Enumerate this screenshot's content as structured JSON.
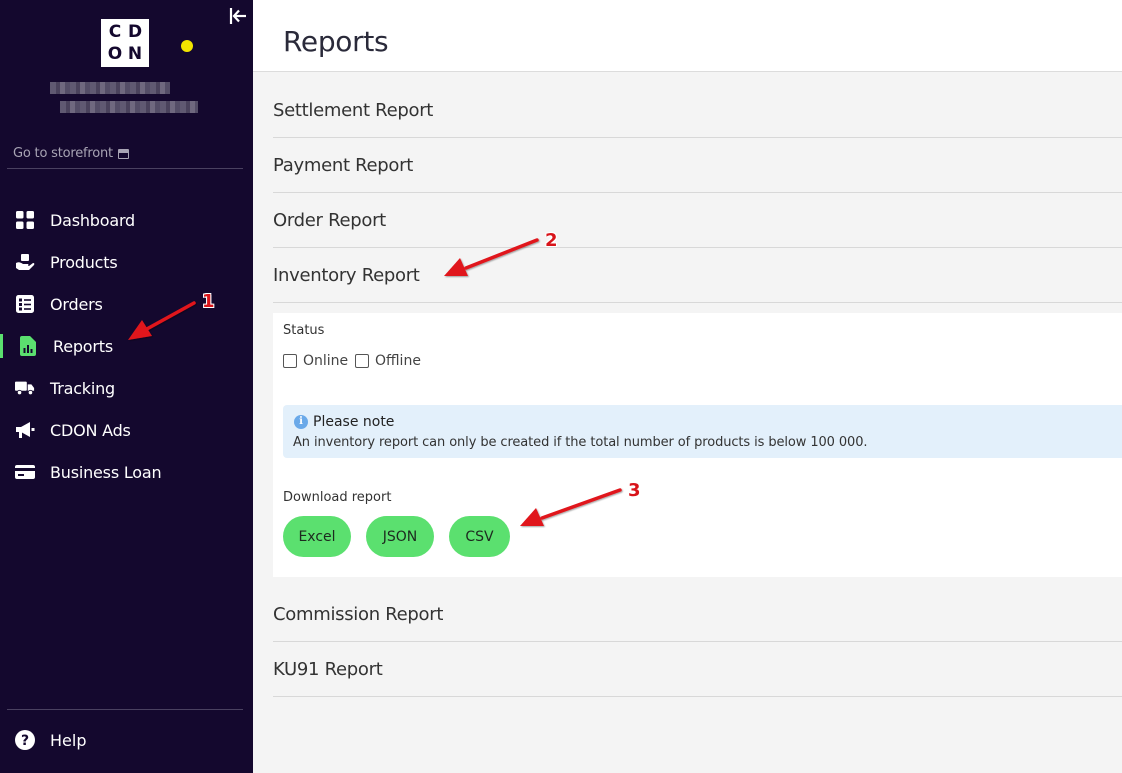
{
  "sidebar": {
    "logo_letters": [
      "C",
      "D",
      "O",
      "N"
    ],
    "storefront_link": "Go to storefront",
    "items": [
      {
        "label": "Dashboard",
        "icon": "grid-icon"
      },
      {
        "label": "Products",
        "icon": "box-hand-icon"
      },
      {
        "label": "Orders",
        "icon": "checklist-icon"
      },
      {
        "label": "Reports",
        "icon": "report-file-icon",
        "active": true
      },
      {
        "label": "Tracking",
        "icon": "truck-icon"
      },
      {
        "label": "CDON Ads",
        "icon": "megaphone-icon"
      },
      {
        "label": "Business Loan",
        "icon": "credit-card-icon"
      }
    ],
    "help_label": "Help",
    "colors": {
      "background": "#14082e",
      "active_accent": "#5be06f",
      "status_dot": "#f2e400"
    }
  },
  "header": {
    "title": "Reports"
  },
  "reports": [
    {
      "label": "Settlement Report"
    },
    {
      "label": "Payment Report"
    },
    {
      "label": "Order Report"
    },
    {
      "label": "Inventory Report",
      "expanded": true
    },
    {
      "label": "Commission Report"
    },
    {
      "label": "KU91 Report"
    }
  ],
  "inventory_panel": {
    "status_label": "Status",
    "checkboxes": [
      {
        "label": "Online",
        "checked": false
      },
      {
        "label": "Offline",
        "checked": false
      }
    ],
    "note": {
      "title": "Please note",
      "body": "An inventory report can only be created if the total number of products is below 100 000."
    },
    "download_label": "Download report",
    "buttons": [
      "Excel",
      "JSON",
      "CSV"
    ],
    "button_color": "#5be06f"
  },
  "annotations": [
    "1",
    "2",
    "3"
  ]
}
